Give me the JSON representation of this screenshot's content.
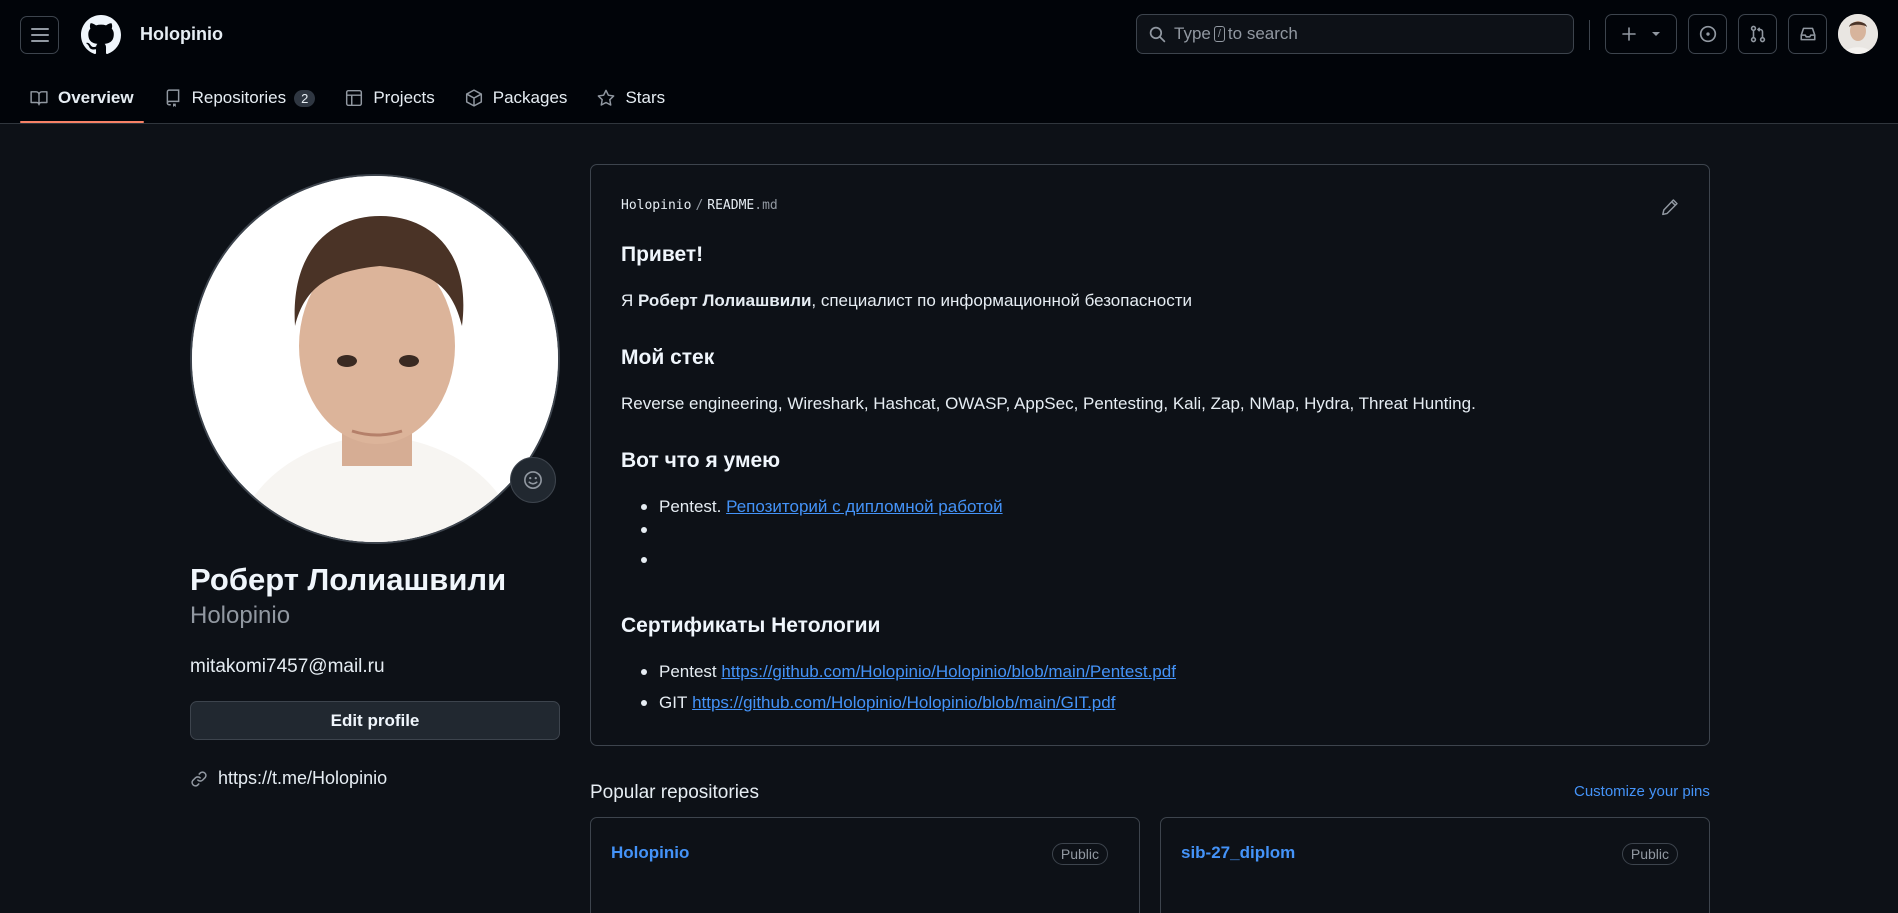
{
  "header": {
    "owner": "Holopinio",
    "search_placeholder_pre": "Type",
    "search_key": "/",
    "search_placeholder_post": "to search"
  },
  "tabs": [
    {
      "label": "Overview",
      "icon": "book-icon",
      "active": true
    },
    {
      "label": "Repositories",
      "icon": "repo-icon",
      "count": "2"
    },
    {
      "label": "Projects",
      "icon": "table-icon"
    },
    {
      "label": "Packages",
      "icon": "package-icon"
    },
    {
      "label": "Stars",
      "icon": "star-icon"
    }
  ],
  "profile": {
    "fullname": "Роберт Лолиашвили",
    "login": "Holopinio",
    "email": "mitakomi7457@mail.ru",
    "edit_label": "Edit profile",
    "link": "https://t.me/Holopinio"
  },
  "readme": {
    "crumb_owner": "Holopinio",
    "crumb_sep": "/",
    "crumb_file": "README",
    "crumb_ext": ".md",
    "h1": "Привет!",
    "intro_pre": "Я",
    "intro_bold": "Роберт Лолиашвили",
    "intro_post": ", специалист по информационной безопасности",
    "h2": "Мой стек",
    "stack": "Reverse engineering, Wireshark, Hashcat, OWASP, AppSec, Pentesting, Kali, Zap, NMap, Hydra, Threat Hunting.",
    "h3": "Вот что я умею",
    "skill1_text": "Pentest.",
    "skill1_link": "Репозиторий с дипломной работой",
    "h4": "Сертификаты Нетологии",
    "cert1_text": "Pentest",
    "cert1_link": "https://github.com/Holopinio/Holopinio/blob/main/Pentest.pdf",
    "cert2_text": "GIT",
    "cert2_link": "https://github.com/Holopinio/Holopinio/blob/main/GIT.pdf"
  },
  "popular": {
    "title": "Popular repositories",
    "customize": "Customize your pins",
    "repos": [
      {
        "name": "Holopinio",
        "visibility": "Public"
      },
      {
        "name": "sib-27_diplom",
        "visibility": "Public"
      }
    ]
  },
  "colors": {
    "bg": "#0d1117",
    "header_bg": "#010409",
    "accent_link": "#4493f8",
    "tab_underline": "#f78166",
    "border": "#3d444d"
  }
}
